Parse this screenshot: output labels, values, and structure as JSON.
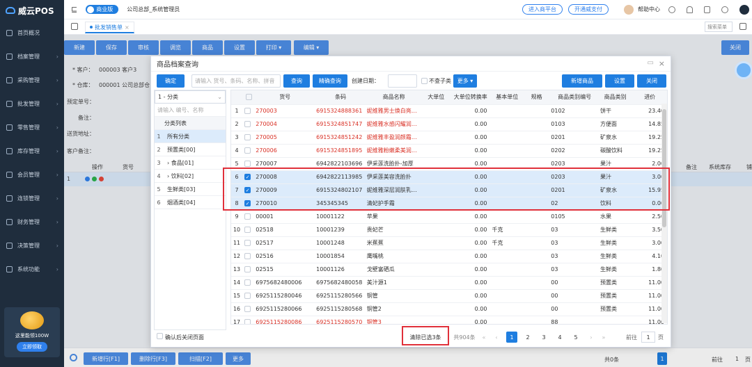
{
  "app": {
    "name": "威云POS",
    "accent": "#1f7ee0",
    "highlight": "#e0303a"
  },
  "sidebar": {
    "items": [
      {
        "label": "首页概况",
        "icon": "home-icon",
        "arrow": false
      },
      {
        "label": "档案管理",
        "icon": "folder-icon",
        "arrow": true
      },
      {
        "label": "采购管理",
        "icon": "cart-icon",
        "arrow": true
      },
      {
        "label": "批发管理",
        "icon": "store-icon",
        "arrow": true
      },
      {
        "label": "零售管理",
        "icon": "register-icon",
        "arrow": true
      },
      {
        "label": "库存管理",
        "icon": "box-icon",
        "arrow": true
      },
      {
        "label": "会员管理",
        "icon": "member-icon",
        "arrow": true
      },
      {
        "label": "连锁管理",
        "icon": "chain-icon",
        "arrow": true
      },
      {
        "label": "财务管理",
        "icon": "finance-icon",
        "arrow": true
      },
      {
        "label": "决策管理",
        "icon": "chart-icon",
        "arrow": true
      },
      {
        "label": "系统功能",
        "icon": "gear-icon",
        "arrow": true
      }
    ],
    "promo": {
      "text": "这里能领100W",
      "button": "立即领取"
    }
  },
  "topbar": {
    "collapse": "⊑",
    "edition": "商业版",
    "org": "公司总部_系统管理员",
    "pill1": "进入商平台",
    "pill2": "开通威支付",
    "help": "帮助中心"
  },
  "tabs": {
    "active": "批发销售单"
  },
  "search_menu": {
    "placeholder": "搜索菜单"
  },
  "toolbar": {
    "new": "新建",
    "save": "保存",
    "audit": "审核",
    "recall": "调览",
    "goods": "商品",
    "settings": "设置",
    "print": "打印 ▾",
    "edit": "编辑 ▾",
    "close": "关闭"
  },
  "form": {
    "customer_label": "* 客户：",
    "customer_value": "000003  客户3",
    "warehouse_label": "* 仓库：",
    "warehouse_value": "000001  公司总部仓",
    "preorder_label": "预定单号：",
    "remark_label": "备注：",
    "address_label": "送货地址：",
    "customer_remark_label": "客户备注：",
    "grid_op": "操作",
    "grid_code": "货号",
    "grid_row": "1",
    "grid_note": "备注",
    "grid_stock": "系统库存",
    "grid_more": "铺"
  },
  "bottom": {
    "add_row": "新增行[F1]",
    "del_row": "删除行[F3]",
    "scan": "扫描[F2]",
    "more": "更多",
    "total": "共0条",
    "page": "1",
    "goto": "前往",
    "page_unit": "页"
  },
  "modal": {
    "title": "商品档案查询",
    "confirm": "确定",
    "search_placeholder": "请输入 货号、条码、名称、拼音",
    "query": "查询",
    "exact_query": "精确查询",
    "create_date_label": "创建日期：",
    "no_subcat_label": "不查子类",
    "more": "更多 ▾",
    "add_goods": "新增商品",
    "settings": "设置",
    "close": "关闭",
    "category_select": "1 - 分类",
    "category_placeholder": "请输入 编号、名称",
    "category_header": "分类列表",
    "categories": [
      {
        "n": "1",
        "label": "所有分类"
      },
      {
        "n": "2",
        "label": "预置类[00]"
      },
      {
        "n": "3",
        "label": "› 食品[01]"
      },
      {
        "n": "4",
        "label": "› 饮料[02]"
      },
      {
        "n": "5",
        "label": "生鲜类[03]"
      },
      {
        "n": "6",
        "label": "烟酒类[04]"
      }
    ],
    "columns": [
      "",
      "",
      "货号",
      "条码",
      "商品名称",
      "大单位",
      "大单位转换率",
      "基本单位",
      "规格",
      "商品类别编号",
      "商品类别",
      "进价"
    ],
    "rows": [
      {
        "n": "1",
        "sel": false,
        "red": true,
        "code": "270003",
        "barcode": "6915324888361",
        "name": "妮维雅男士焕白亮…",
        "big": "",
        "rate": "0.00",
        "unit": "",
        "spec": "",
        "catno": "0102",
        "cat": "饼干",
        "price": "23.40"
      },
      {
        "n": "2",
        "sel": false,
        "red": true,
        "code": "270004",
        "barcode": "6915324851747",
        "name": "妮维雅水感闪耀润…",
        "big": "",
        "rate": "0.00",
        "unit": "",
        "spec": "",
        "catno": "0103",
        "cat": "方便面",
        "price": "14.85"
      },
      {
        "n": "3",
        "sel": false,
        "red": true,
        "code": "270005",
        "barcode": "6915324851242",
        "name": "妮维雅丰盈润颜霜…",
        "big": "",
        "rate": "0.00",
        "unit": "",
        "spec": "",
        "catno": "0201",
        "cat": "矿泉水",
        "price": "19.25"
      },
      {
        "n": "4",
        "sel": false,
        "red": true,
        "code": "270006",
        "barcode": "6915324851895",
        "name": "妮维雅粉嫩柔美润…",
        "big": "",
        "rate": "0.00",
        "unit": "",
        "spec": "",
        "catno": "0202",
        "cat": "碳酸饮料",
        "price": "19.25"
      },
      {
        "n": "5",
        "sel": false,
        "red": false,
        "code": "270007",
        "barcode": "6942822103696",
        "name": "伊采莲洗脸扑-加厚",
        "big": "",
        "rate": "0.00",
        "unit": "",
        "spec": "",
        "catno": "0203",
        "cat": "果汁",
        "price": "2.00"
      },
      {
        "n": "6",
        "sel": true,
        "red": false,
        "code": "270008",
        "barcode": "6942822113985",
        "name": "伊采莲美容洗脸扑",
        "big": "",
        "rate": "0.00",
        "unit": "",
        "spec": "",
        "catno": "0203",
        "cat": "果汁",
        "price": "3.00"
      },
      {
        "n": "7",
        "sel": true,
        "red": false,
        "code": "270009",
        "barcode": "6915324802107",
        "name": "妮维雅深层润肤乳…",
        "big": "",
        "rate": "0.00",
        "unit": "",
        "spec": "",
        "catno": "0201",
        "cat": "矿泉水",
        "price": "15.95"
      },
      {
        "n": "8",
        "sel": true,
        "red": false,
        "code": "270010",
        "barcode": "345345345",
        "name": "清妃护手霜",
        "big": "",
        "rate": "0.00",
        "unit": "",
        "spec": "",
        "catno": "02",
        "cat": "饮料",
        "price": "0.00"
      },
      {
        "n": "9",
        "sel": false,
        "red": false,
        "code": "00001",
        "barcode": "10001122",
        "name": "苹果",
        "big": "",
        "rate": "0.00",
        "unit": "",
        "spec": "",
        "catno": "0105",
        "cat": "水果",
        "price": "2.50"
      },
      {
        "n": "10",
        "sel": false,
        "red": false,
        "code": "02518",
        "barcode": "10001239",
        "name": "贵妃芒",
        "big": "",
        "rate": "0.00",
        "unit": "千克",
        "spec": "",
        "catno": "03",
        "cat": "生鲜类",
        "price": "3.50"
      },
      {
        "n": "11",
        "sel": false,
        "red": false,
        "code": "02517",
        "barcode": "10001248",
        "name": "米蕉蕉",
        "big": "",
        "rate": "0.00",
        "unit": "千克",
        "spec": "",
        "catno": "03",
        "cat": "生鲜类",
        "price": "3.00"
      },
      {
        "n": "12",
        "sel": false,
        "red": false,
        "code": "02516",
        "barcode": "10001854",
        "name": "鹰嘴桃",
        "big": "",
        "rate": "0.00",
        "unit": "",
        "spec": "",
        "catno": "03",
        "cat": "生鲜类",
        "price": "4.10"
      },
      {
        "n": "13",
        "sel": false,
        "red": false,
        "code": "02515",
        "barcode": "10001126",
        "name": "戈壁富硒瓜",
        "big": "",
        "rate": "0.00",
        "unit": "",
        "spec": "",
        "catno": "03",
        "cat": "生鲜类",
        "price": "1.80"
      },
      {
        "n": "14",
        "sel": false,
        "red": false,
        "code": "6975682480006",
        "barcode": "6975682480058",
        "name": "美汁源1",
        "big": "",
        "rate": "0.00",
        "unit": "",
        "spec": "",
        "catno": "00",
        "cat": "预置类",
        "price": "11.00"
      },
      {
        "n": "15",
        "sel": false,
        "red": false,
        "code": "6925115280046",
        "barcode": "6925115280566",
        "name": "铜管",
        "big": "",
        "rate": "0.00",
        "unit": "",
        "spec": "",
        "catno": "00",
        "cat": "预置类",
        "price": "11.00"
      },
      {
        "n": "16",
        "sel": false,
        "red": false,
        "code": "6925115280066",
        "barcode": "6925115280568",
        "name": "铜管2",
        "big": "",
        "rate": "0.00",
        "unit": "",
        "spec": "",
        "catno": "00",
        "cat": "预置类",
        "price": "11.00"
      },
      {
        "n": "17",
        "sel": false,
        "red": true,
        "code": "6925115280086",
        "barcode": "6925115280570",
        "name": "铜管3",
        "big": "",
        "rate": "0.00",
        "unit": "",
        "spec": "",
        "catno": "88",
        "cat": "",
        "price": "11.00"
      }
    ],
    "close_after_confirm": "确认后关闭页面",
    "clear_selected": "清除已选3条",
    "total": "共904条",
    "pages": [
      "1",
      "2",
      "3",
      "4",
      "5"
    ],
    "goto": "前往",
    "goto_value": "1",
    "page_unit": "页"
  }
}
